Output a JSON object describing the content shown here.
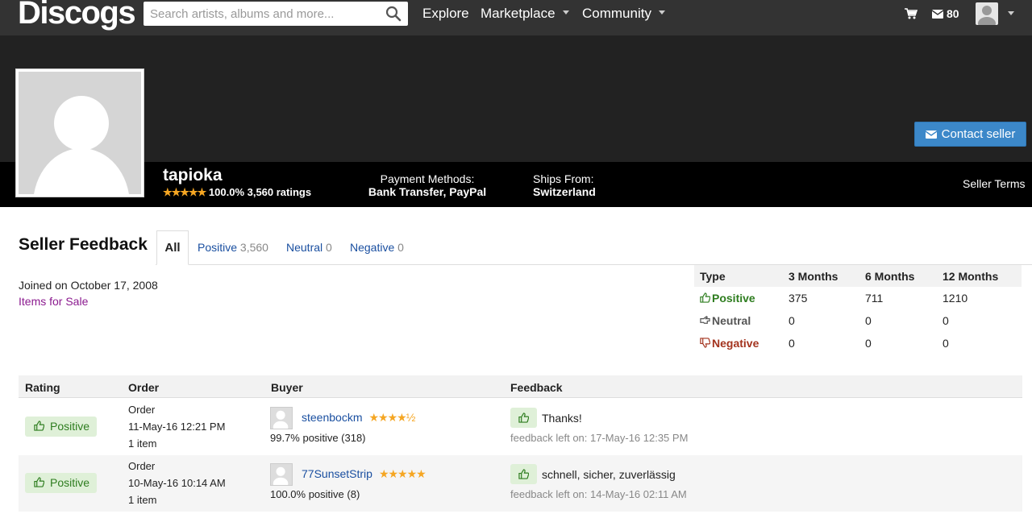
{
  "nav": {
    "logo": "Discogs",
    "search_placeholder": "Search artists, albums and more...",
    "explore": "Explore",
    "marketplace": "Marketplace",
    "community": "Community",
    "mail_count": "80"
  },
  "seller": {
    "username": "tapioka",
    "stars": "★★★★★",
    "rating_text": "100.0% 3,560 ratings",
    "payment_label": "Payment Methods:",
    "payment_value": "Bank Transfer, PayPal",
    "ships_label": "Ships From:",
    "ships_value": "Switzerland",
    "seller_terms": "Seller Terms",
    "contact": "Contact seller"
  },
  "feedback": {
    "title": "Seller Feedback",
    "tabs": [
      {
        "label": "All"
      },
      {
        "label": "Positive",
        "count": "3,560"
      },
      {
        "label": "Neutral",
        "count": "0"
      },
      {
        "label": "Negative",
        "count": "0"
      }
    ],
    "joined": "Joined on October 17, 2008",
    "items_for_sale": "Items for Sale"
  },
  "summary": {
    "headers": [
      "Type",
      "3 Months",
      "6 Months",
      "12 Months"
    ],
    "rows": [
      {
        "type": "Positive",
        "m3": "375",
        "m6": "711",
        "m12": "1210"
      },
      {
        "type": "Neutral",
        "m3": "0",
        "m6": "0",
        "m12": "0"
      },
      {
        "type": "Negative",
        "m3": "0",
        "m6": "0",
        "m12": "0"
      }
    ]
  },
  "table": {
    "headers": [
      "Rating",
      "Order",
      "Buyer",
      "Feedback"
    ],
    "rows": [
      {
        "rating": "Positive",
        "order_label": "Order",
        "order_date": "11-May-16 12:21 PM",
        "order_items": "1 item",
        "buyer": "steenbockm",
        "buyer_stars": "★★★★½",
        "buyer_pct": "99.7% positive (318)",
        "feedback": "Thanks!",
        "feedback_date": "feedback left on: 17-May-16 12:35 PM"
      },
      {
        "rating": "Positive",
        "order_label": "Order",
        "order_date": "10-May-16 10:14 AM",
        "order_items": "1 item",
        "buyer": "77SunsetStrip",
        "buyer_stars": "★★★★★",
        "buyer_pct": "100.0% positive (8)",
        "feedback": "schnell, sicher, zuverlässig",
        "feedback_date": "feedback left on: 14-May-16 02:11 AM"
      }
    ]
  },
  "colors": {
    "nav_bg": "#333333",
    "banner_bg": "#222222",
    "seller_bar_bg": "#000000",
    "accent_blue": "#3c88c9",
    "link_blue": "#1a4fa0",
    "positive_green": "#2e7d1f",
    "negative_red": "#a3331e",
    "star_gold": "#f5a623"
  },
  "icons": [
    "search-icon",
    "cart-icon",
    "mail-icon",
    "user-icon",
    "envelope-icon",
    "thumbs-up-icon",
    "thumbs-down-icon",
    "neutral-hand-icon"
  ]
}
